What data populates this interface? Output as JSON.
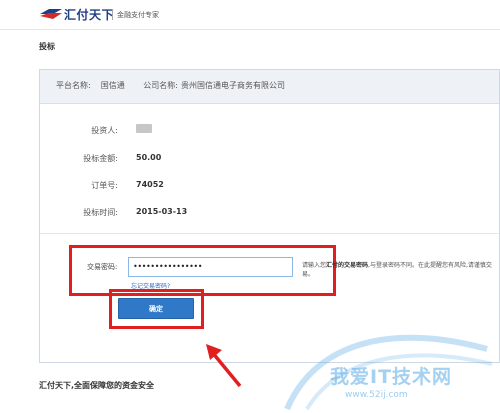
{
  "header": {
    "logo_text": "汇付天下",
    "tagline": "金融支付专家"
  },
  "page_title": "投标",
  "panel": {
    "platform_label": "平台名称:",
    "platform_value": "国信通",
    "company_label": "公司名称:",
    "company_value": "贵州国信通电子商务有限公司"
  },
  "details": [
    {
      "label": "投资人:",
      "value": ""
    },
    {
      "label": "投标金额:",
      "value": "50.00"
    },
    {
      "label": "订单号:",
      "value": "74052"
    },
    {
      "label": "投标时间:",
      "value": "2015-03-13"
    }
  ],
  "password": {
    "label": "交易密码:",
    "value": "••••••••••••••••",
    "forgot_link": "忘记交易密码?",
    "hint_prefix": "请输入您",
    "hint_bold": "汇付的交易密码",
    "hint_suffix": ",与登录密码不同。在此提醒您有风险,请谨慎交易。"
  },
  "confirm_button": "确定",
  "footer": "汇付天下,全面保障您的资金安全",
  "watermark": {
    "text": "我爱IT技术网",
    "url": "www.52ij.com"
  },
  "colors": {
    "highlight": "#e02020",
    "button": "#3078c8",
    "panel_head": "#eef2f7"
  }
}
